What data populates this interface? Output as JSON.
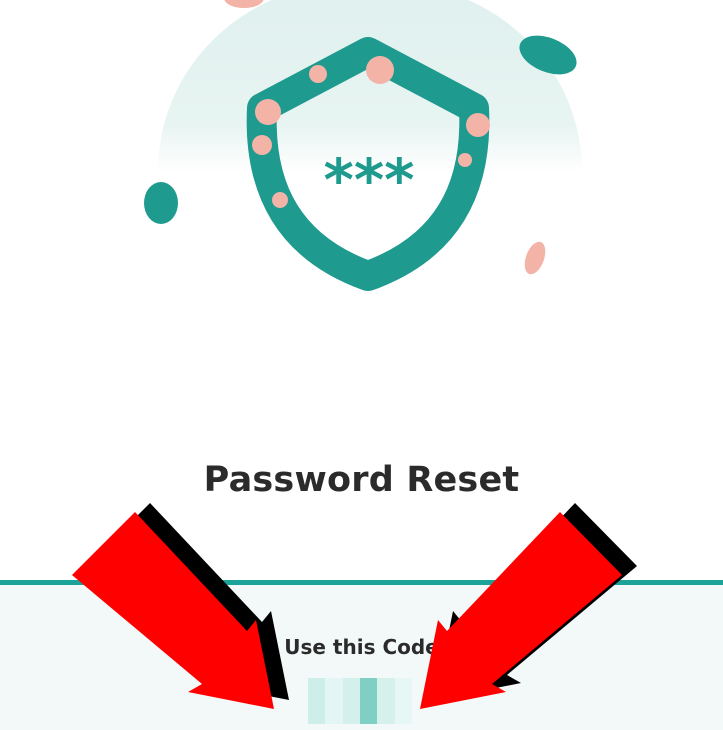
{
  "email": {
    "title": "Password Reset",
    "code_label": "Use this Code"
  },
  "illustration": {
    "icon": "shield-icon",
    "masked_text": "***"
  },
  "annotations": {
    "arrow_color": "#ff0000"
  },
  "colors": {
    "accent": "#1ba39a",
    "shield": "#1f9a8e",
    "spots": "#f4b3a7",
    "panel_background": "#f3f9f8",
    "text": "#2b2b2b"
  }
}
